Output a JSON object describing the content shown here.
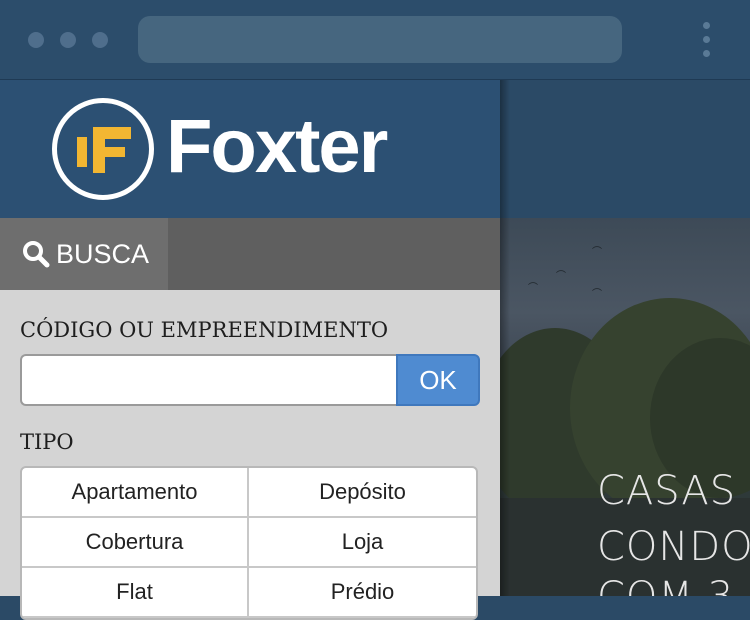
{
  "browser": {
    "window_controls": [
      "dot",
      "dot",
      "dot"
    ],
    "menu_icon": "kebab-icon"
  },
  "brand": {
    "name": "Foxter",
    "logo_icon": "foxter-logo-mark",
    "colors": {
      "band": "#2c5073",
      "mark": "#f2b632"
    }
  },
  "search_tab": {
    "label": "BUSCA",
    "icon": "search-icon"
  },
  "form": {
    "code_label": "CÓDIGO OU EMPREENDIMENTO",
    "code_value": "",
    "code_placeholder": "",
    "ok_label": "OK",
    "tipo_label": "TIPO",
    "tipo_options": [
      "Apartamento",
      "Depósito",
      "Cobertura",
      "Loja",
      "Flat",
      "Prédio"
    ]
  },
  "hero": {
    "lines": [
      "CASAS",
      "CONDO",
      "COM 3"
    ]
  },
  "accent_colors": {
    "ok_button": "#4f8bd1"
  }
}
